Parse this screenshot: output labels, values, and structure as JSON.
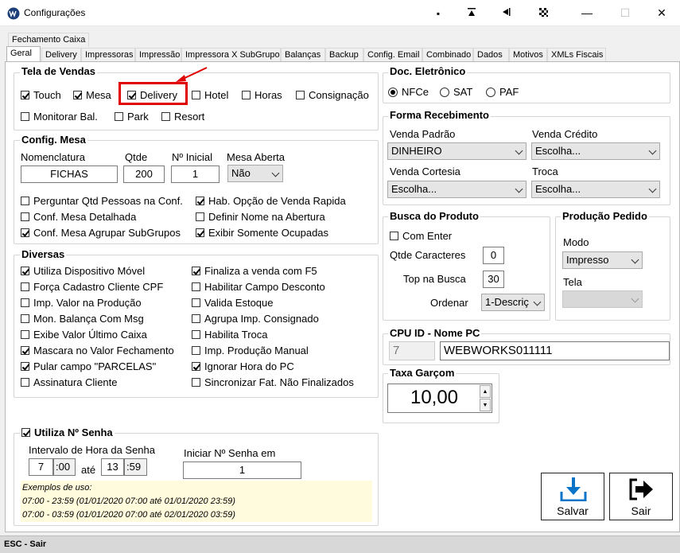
{
  "window": {
    "title": "Configurações"
  },
  "tabs": {
    "row1": [
      "Fechamento Caixa"
    ],
    "row2": [
      "Geral",
      "Delivery",
      "Impressoras",
      "Impressão",
      "Impressora X SubGrupo",
      "Balanças",
      "Backup",
      "Config. Email",
      "Combinado",
      "Dados",
      "Motivos",
      "XMLs Fiscais"
    ]
  },
  "tela_vendas": {
    "title": "Tela de Vendas",
    "options": [
      {
        "label": "Touch",
        "checked": true
      },
      {
        "label": "Mesa",
        "checked": true
      },
      {
        "label": "Delivery",
        "checked": true
      },
      {
        "label": "Hotel",
        "checked": false
      },
      {
        "label": "Horas",
        "checked": false
      },
      {
        "label": "Consignação",
        "checked": false
      },
      {
        "label": "Monitorar Bal.",
        "checked": false
      },
      {
        "label": "Park",
        "checked": false
      },
      {
        "label": "Resort",
        "checked": false
      }
    ]
  },
  "config_mesa": {
    "title": "Config. Mesa",
    "nomenclatura_label": "Nomenclatura",
    "nomenclatura_value": "FICHAS",
    "qtde_label": "Qtde",
    "qtde_value": "200",
    "inicial_label": "Nº Inicial",
    "inicial_value": "1",
    "aberta_label": "Mesa Aberta",
    "aberta_value": "Não",
    "options": [
      {
        "label": "Perguntar Qtd Pessoas na Conf.",
        "checked": false
      },
      {
        "label": "Hab. Opção de Venda Rapida",
        "checked": true
      },
      {
        "label": "Conf. Mesa Detalhada",
        "checked": false
      },
      {
        "label": "Definir Nome na Abertura",
        "checked": false
      },
      {
        "label": "Conf. Mesa Agrupar SubGrupos",
        "checked": true
      },
      {
        "label": "Exibir Somente Ocupadas",
        "checked": true
      }
    ]
  },
  "diversas": {
    "title": "Diversas",
    "options": [
      {
        "label": "Utiliza Dispositivo Móvel",
        "checked": true
      },
      {
        "label": "Finaliza a venda com F5",
        "checked": true
      },
      {
        "label": "Força Cadastro Cliente CPF",
        "checked": false
      },
      {
        "label": "Habilitar Campo Desconto",
        "checked": false
      },
      {
        "label": "Imp. Valor na Produção",
        "checked": false
      },
      {
        "label": "Valida Estoque",
        "checked": false
      },
      {
        "label": "Mon. Balança Com Msg",
        "checked": false
      },
      {
        "label": "Agrupa Imp. Consignado",
        "checked": false
      },
      {
        "label": "Exibe Valor Último Caixa",
        "checked": false
      },
      {
        "label": "Habilita Troca",
        "checked": false
      },
      {
        "label": "Mascara no Valor Fechamento",
        "checked": true
      },
      {
        "label": "Imp. Produção Manual",
        "checked": false
      },
      {
        "label": "Pular campo \"PARCELAS\"",
        "checked": true
      },
      {
        "label": "Ignorar Hora do PC",
        "checked": true
      },
      {
        "label": "Assinatura Cliente",
        "checked": false
      },
      {
        "label": "Sincronizar Fat. Não Finalizados",
        "checked": false
      }
    ]
  },
  "senha": {
    "title": "Utiliza Nº Senha",
    "checked": true,
    "intervalo_label": "Intervalo de Hora da Senha",
    "h1": "7",
    "m1": ":00",
    "ate": "até",
    "h2": "13",
    "m2": ":59",
    "iniciar_label": "Iniciar Nº Senha em",
    "iniciar_value": "1",
    "examples": [
      "Exemplos de uso:",
      "07:00 - 23:59 (01/01/2020 07:00 até 01/01/2020 23:59)",
      "07:00 - 03:59 (01/01/2020 07:00 até 02/01/2020 03:59)"
    ]
  },
  "doc_eletronico": {
    "title": "Doc. Eletrônico",
    "options": [
      {
        "label": "NFCe",
        "selected": true
      },
      {
        "label": "SAT",
        "selected": false
      },
      {
        "label": "PAF",
        "selected": false
      }
    ]
  },
  "forma_recebimento": {
    "title": "Forma Recebimento",
    "venda_padrao_label": "Venda Padrão",
    "venda_padrao_value": "DINHEIRO",
    "venda_credito_label": "Venda Crédito",
    "venda_credito_value": "Escolha...",
    "venda_cortesia_label": "Venda Cortesia",
    "venda_cortesia_value": "Escolha...",
    "troca_label": "Troca",
    "troca_value": "Escolha..."
  },
  "busca_produto": {
    "title": "Busca do Produto",
    "com_enter_label": "Com Enter",
    "com_enter_checked": false,
    "qtde_label": "Qtde Caracteres",
    "qtde_value": "0",
    "top_label": "Top na Busca",
    "top_value": "30",
    "ordenar_label": "Ordenar",
    "ordenar_value": "1-Descriç"
  },
  "producao_pedido": {
    "title": "Produção Pedido",
    "modo_label": "Modo",
    "modo_value": "Impresso",
    "tela_label": "Tela",
    "tela_value": ""
  },
  "cpu": {
    "title": "CPU ID - Nome PC",
    "id_value": "7",
    "name_value": "WEBWORKS011111"
  },
  "taxa": {
    "title": "Taxa Garçom",
    "value": "10,00"
  },
  "actions": {
    "salvar": "Salvar",
    "sair": "Sair"
  },
  "status": {
    "text": "ESC - Sair"
  },
  "colors": {
    "highlight": "#e00000",
    "accent": "#0a74c9",
    "example_bg": "#fffbdc"
  }
}
